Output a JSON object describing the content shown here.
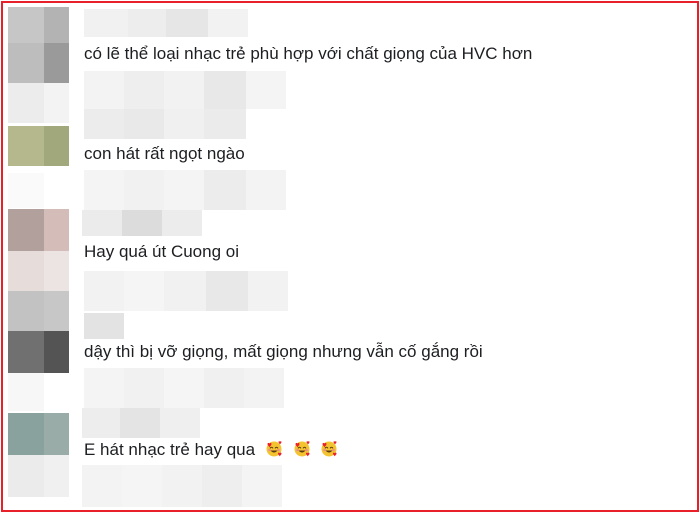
{
  "comments": [
    {
      "text": "có lẽ thể loại nhạc trẻ phù hợp với chất giọng của HVC hơn"
    },
    {
      "text": "con hát rất ngọt ngào"
    },
    {
      "text": "Hay quá út Cuong oi"
    },
    {
      "text": "dậy thì bị vỡ giọng, mất giọng nhưng vẫn cố gắng rồi"
    },
    {
      "text": "E hát nhạc trẻ hay qua",
      "emoji": [
        "smiling-face-with-hearts",
        "smiling-face-with-hearts",
        "smiling-face-with-hearts"
      ]
    }
  ],
  "colors": {
    "frame_border": "#e8202a",
    "text": "#1c1e21",
    "pixelated_placeholder": "#efefef"
  }
}
